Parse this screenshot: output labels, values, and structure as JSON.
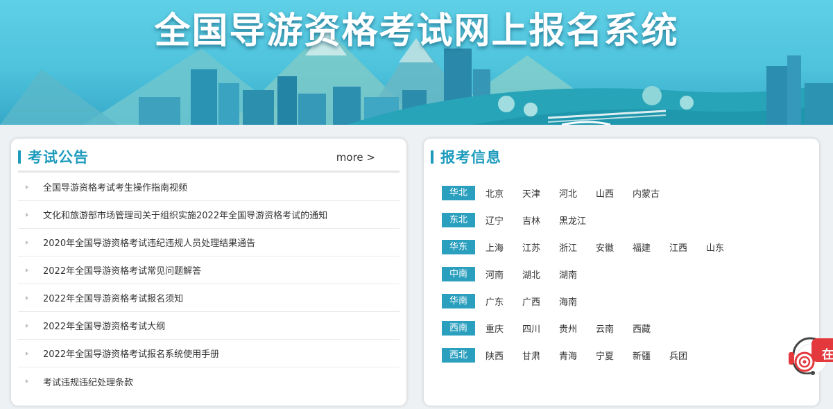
{
  "banner": {
    "title": "全国导游资格考试网上报名系统"
  },
  "announcements": {
    "title": "考试公告",
    "more_label": "more >",
    "items": [
      "全国导游资格考试考生操作指南视频",
      "文化和旅游部市场管理司关于组织实施2022年全国导游资格考试的通知",
      "2020年全国导游资格考试违纪违规人员处理结果通告",
      "2022年全国导游资格考试常见问题解答",
      "2022年全国导游资格考试报名须知",
      "2022年全国导游资格考试大纲",
      "2022年全国导游资格考试报名系统使用手册",
      "考试违规违纪处理条款"
    ]
  },
  "registration": {
    "title": "报考信息",
    "regions": [
      {
        "name": "华北",
        "provinces": [
          "北京",
          "天津",
          "河北",
          "山西",
          "内蒙古"
        ]
      },
      {
        "name": "东北",
        "provinces": [
          "辽宁",
          "吉林",
          "黑龙江"
        ]
      },
      {
        "name": "华东",
        "provinces": [
          "上海",
          "江苏",
          "浙江",
          "安徽",
          "福建",
          "江西",
          "山东"
        ]
      },
      {
        "name": "中南",
        "provinces": [
          "河南",
          "湖北",
          "湖南"
        ]
      },
      {
        "name": "华南",
        "provinces": [
          "广东",
          "广西",
          "海南"
        ]
      },
      {
        "name": "西南",
        "provinces": [
          "重庆",
          "四川",
          "贵州",
          "云南",
          "西藏"
        ]
      },
      {
        "name": "西北",
        "provinces": [
          "陕西",
          "甘肃",
          "青海",
          "宁夏",
          "新疆",
          "兵团"
        ]
      }
    ]
  },
  "floating_service": {
    "label": "在",
    "icon": "customer-service-headset-icon"
  },
  "colors": {
    "accent": "#1d9bbd",
    "region_tag": "#2b9fbe",
    "banner_sky": "#5fd0e6",
    "service_red": "#e4393c"
  }
}
